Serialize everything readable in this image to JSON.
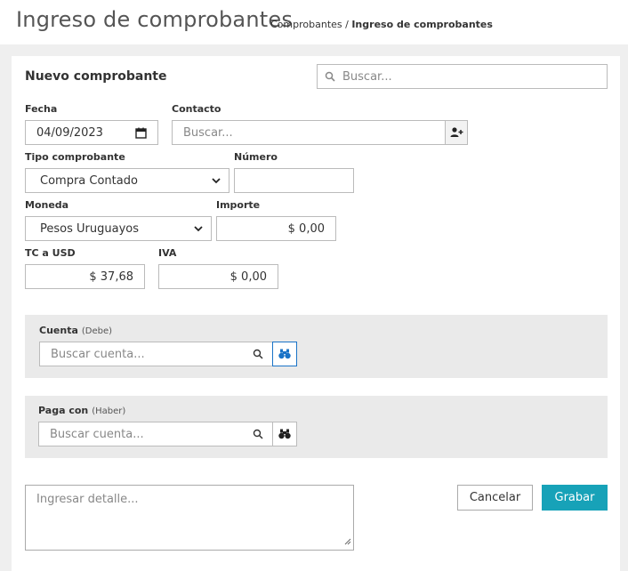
{
  "header": {
    "title": "Ingreso de comprobantes",
    "breadcrumb_parent": "Comprobantes",
    "breadcrumb_sep": " / ",
    "breadcrumb_current": "Ingreso de comprobantes"
  },
  "form": {
    "title": "Nuevo comprobante",
    "search_placeholder": "Buscar...",
    "fecha_label": "Fecha",
    "fecha_value": "04/09/2023",
    "contacto_label": "Contacto",
    "contacto_placeholder": "Buscar...",
    "tipo_label": "Tipo comprobante",
    "tipo_value": "Compra Contado",
    "numero_label": "Número",
    "numero_value": "",
    "moneda_label": "Moneda",
    "moneda_value": "Pesos Uruguayos",
    "importe_label": "Importe",
    "importe_value": "$ 0,00",
    "tc_label": "TC a USD",
    "tc_value": "$ 37,68",
    "iva_label": "IVA",
    "iva_value": "$ 0,00"
  },
  "cuenta": {
    "label": "Cuenta",
    "sub": "(Debe)",
    "placeholder": "Buscar cuenta..."
  },
  "paga": {
    "label": "Paga con",
    "sub": "(Haber)",
    "placeholder": "Buscar cuenta..."
  },
  "detalle_placeholder": "Ingresar detalle...",
  "buttons": {
    "cancel": "Cancelar",
    "save": "Grabar"
  },
  "colors": {
    "accent": "#17a2b8",
    "binoculars_active": "#1a73c7",
    "panel_gray": "#eaeaea"
  },
  "icons": {
    "search": "search-icon",
    "add_contact": "user-plus-icon",
    "calendar": "calendar-icon",
    "chevron": "chevron-down-icon",
    "binoculars": "binoculars-icon"
  }
}
